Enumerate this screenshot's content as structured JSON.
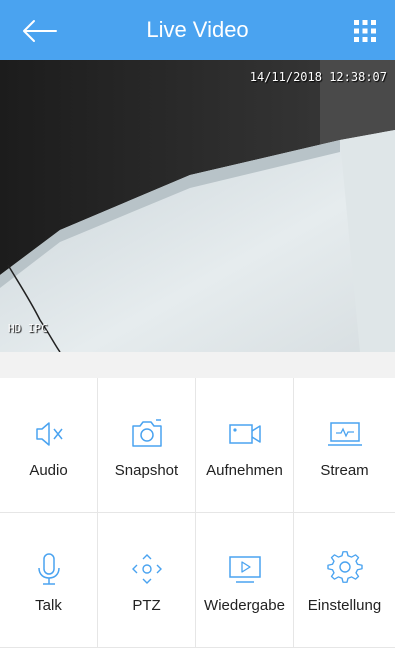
{
  "header": {
    "title": "Live Video",
    "bg_color": "#4aa3f0",
    "back_icon": "arrow-left-icon",
    "menu_icon": "grid-menu-icon"
  },
  "video": {
    "timestamp": "14/11/2018 12:38:07",
    "watermark": "HD IPC"
  },
  "controls": [
    {
      "label": "Audio",
      "icon": "speaker-mute-icon"
    },
    {
      "label": "Snapshot",
      "icon": "camera-icon"
    },
    {
      "label": "Aufnehmen",
      "icon": "video-record-icon"
    },
    {
      "label": "Stream",
      "icon": "stream-monitor-icon"
    },
    {
      "label": "Talk",
      "icon": "microphone-icon"
    },
    {
      "label": "PTZ",
      "icon": "ptz-arrows-icon"
    },
    {
      "label": "Wiedergabe",
      "icon": "playback-icon"
    },
    {
      "label": "Einstellung",
      "icon": "gear-icon"
    }
  ],
  "accent_color": "#4aa3f0"
}
